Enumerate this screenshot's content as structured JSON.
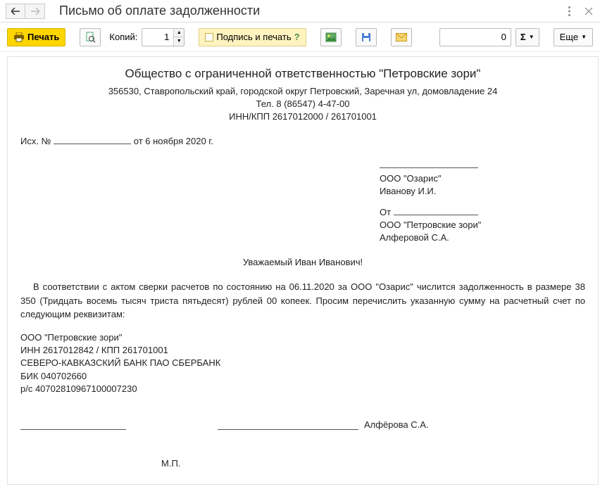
{
  "titlebar": {
    "title": "Письмо об оплате задолженности"
  },
  "toolbar": {
    "print_label": "Печать",
    "copies_label": "Копий:",
    "copies_value": "1",
    "sign_print_label": "Подпись и печать",
    "sign_print_q": "?",
    "sum_value": "0",
    "sigma_label": "Σ",
    "more_label": "Еще"
  },
  "doc": {
    "org_name": "Общество с ограниченной ответственностью \"Петровские зори\"",
    "address": "356530, Ставропольский край, городской округ Петровский, Заречная ул, домовладение 24",
    "phone": "Тел. 8 (86547) 4-47-00",
    "innkpp": "ИНН/КПП 2617012000 / 261701001",
    "ref_prefix": "Исх. №",
    "ref_date": "от 6 ноября 2020 г.",
    "recipient_org": "ООО \"Озарис\"",
    "recipient_person": "Иванову  И.И.",
    "from_label": "От",
    "sender_org": "ООО \"Петровские зори\"",
    "sender_person": "Алферовой С.А.",
    "salutation": "Уважаемый Иван Иванович!",
    "body": "В соответствии с актом сверки расчетов по состоянию на 06.11.2020 за ООО \"Озарис\" числится задолженность в размере 38 350 (Тридцать восемь тысяч триста пятьдесят) рублей 00 копеек. Просим перечислить указанную сумму на расчетный счет  по следующим реквизитам:",
    "req_org": "ООО \"Петровские зори\"",
    "req_inn": "ИНН 2617012842 / КПП 261701001",
    "req_bank": "СЕВЕРО-КАВКАЗСКИЙ БАНК ПАО СБЕРБАНК",
    "req_bik": "БИК 040702660",
    "req_acc": "р/с 40702810967100007230",
    "signatory": "Алфёрова С.А.",
    "stamp": "М.П."
  }
}
